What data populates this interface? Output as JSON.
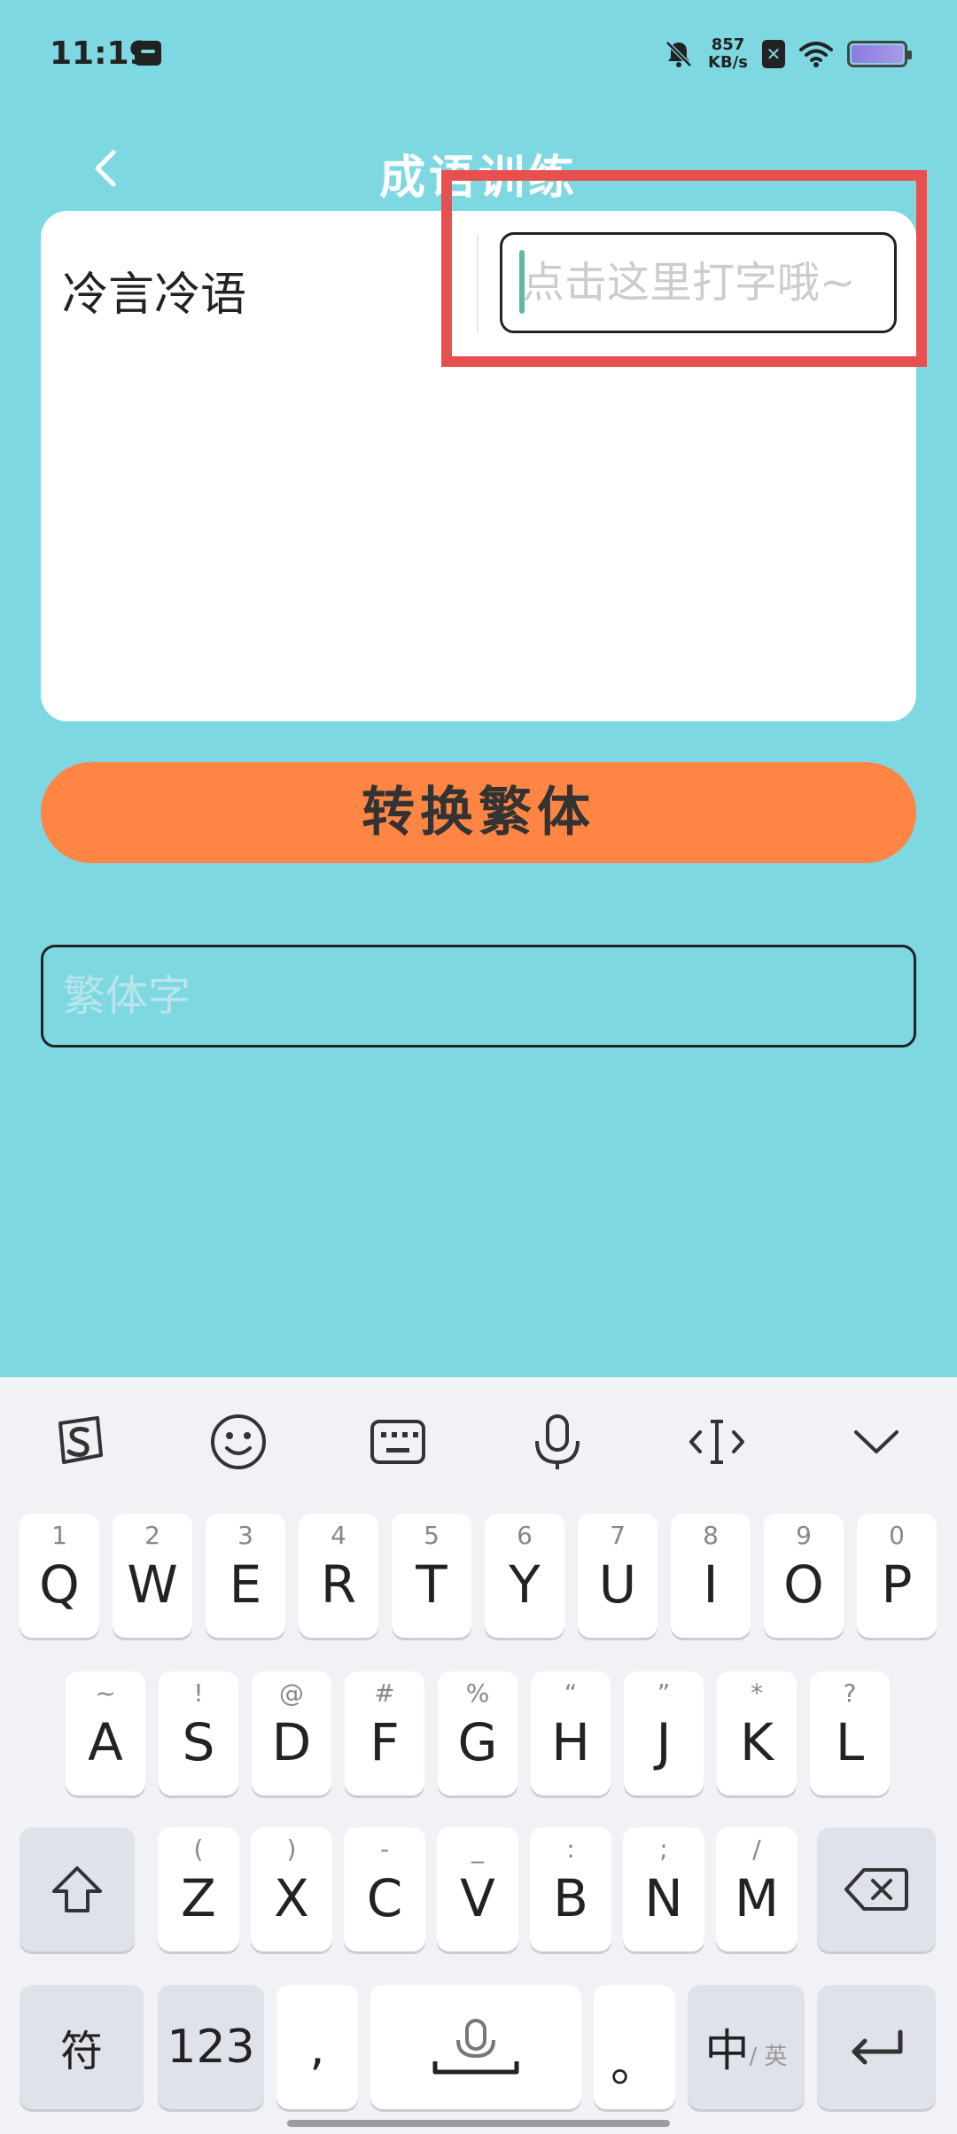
{
  "status_bar": {
    "time": "11:19",
    "net_speed_value": "857",
    "net_speed_unit": "KB/s",
    "sim_label": "✕"
  },
  "header": {
    "title": "成语训练"
  },
  "card": {
    "idiom": "冷言冷语",
    "answer_placeholder": "点击这里打字哦~",
    "answer_value": ""
  },
  "convert_button_label": "转换繁体",
  "result_placeholder": "繁体字",
  "keyboard": {
    "toolbar_icons": [
      "sogou-logo-icon",
      "emoji-icon",
      "keyboard-icon",
      "microphone-icon",
      "text-cursor-icon",
      "collapse-icon"
    ],
    "row1": [
      {
        "main": "Q",
        "sup": "1"
      },
      {
        "main": "W",
        "sup": "2"
      },
      {
        "main": "E",
        "sup": "3"
      },
      {
        "main": "R",
        "sup": "4"
      },
      {
        "main": "T",
        "sup": "5"
      },
      {
        "main": "Y",
        "sup": "6"
      },
      {
        "main": "U",
        "sup": "7"
      },
      {
        "main": "I",
        "sup": "8"
      },
      {
        "main": "O",
        "sup": "9"
      },
      {
        "main": "P",
        "sup": "0"
      }
    ],
    "row2": [
      {
        "main": "A",
        "sup": "~"
      },
      {
        "main": "S",
        "sup": "!"
      },
      {
        "main": "D",
        "sup": "@"
      },
      {
        "main": "F",
        "sup": "#"
      },
      {
        "main": "G",
        "sup": "%"
      },
      {
        "main": "H",
        "sup": "“"
      },
      {
        "main": "J",
        "sup": "”"
      },
      {
        "main": "K",
        "sup": "*"
      },
      {
        "main": "L",
        "sup": "?"
      }
    ],
    "row3": [
      {
        "main": "Z",
        "sup": "("
      },
      {
        "main": "X",
        "sup": ")"
      },
      {
        "main": "C",
        "sup": "-"
      },
      {
        "main": "V",
        "sup": "_"
      },
      {
        "main": "B",
        "sup": ":"
      },
      {
        "main": "N",
        "sup": ";"
      },
      {
        "main": "M",
        "sup": "/"
      }
    ],
    "symbols_label": "符",
    "numbers_label": "123",
    "comma_label": ",",
    "period_label": "。",
    "lang_label": "中",
    "lang_sub_label": "/ 英"
  }
}
